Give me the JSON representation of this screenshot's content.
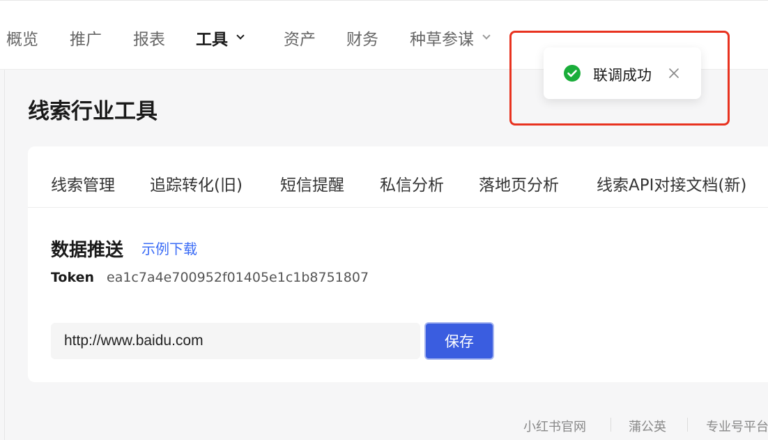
{
  "topnav": {
    "items": [
      {
        "label": "概览"
      },
      {
        "label": "推广"
      },
      {
        "label": "报表"
      },
      {
        "label": "工具"
      },
      {
        "label": "资产"
      },
      {
        "label": "财务"
      },
      {
        "label": "种草参谋"
      }
    ],
    "active_item": "工具"
  },
  "page": {
    "title": "线索行业工具"
  },
  "tabs": [
    {
      "label": "线索管理"
    },
    {
      "label": "追踪转化(旧)"
    },
    {
      "label": "短信提醒"
    },
    {
      "label": "私信分析"
    },
    {
      "label": "落地页分析"
    },
    {
      "label": "线索API对接文档(新)"
    }
  ],
  "push": {
    "title": "数据推送",
    "sample_link": "示例下载",
    "token_label": "Token",
    "token_value": "ea1c7a4e700952f01405e1c1b8751807",
    "url_value": "http://www.baidu.com",
    "save_label": "保存"
  },
  "footer": {
    "links": [
      {
        "label": "小红书官网"
      },
      {
        "label": "蒲公英"
      },
      {
        "label": "专业号平台"
      }
    ]
  },
  "toast": {
    "message": "联调成功",
    "icon": "check-circle-icon",
    "color": "#1aad3a"
  },
  "colors": {
    "accent": "#3a5de0",
    "link": "#3b6cf6",
    "annotation": "#e8321f"
  }
}
